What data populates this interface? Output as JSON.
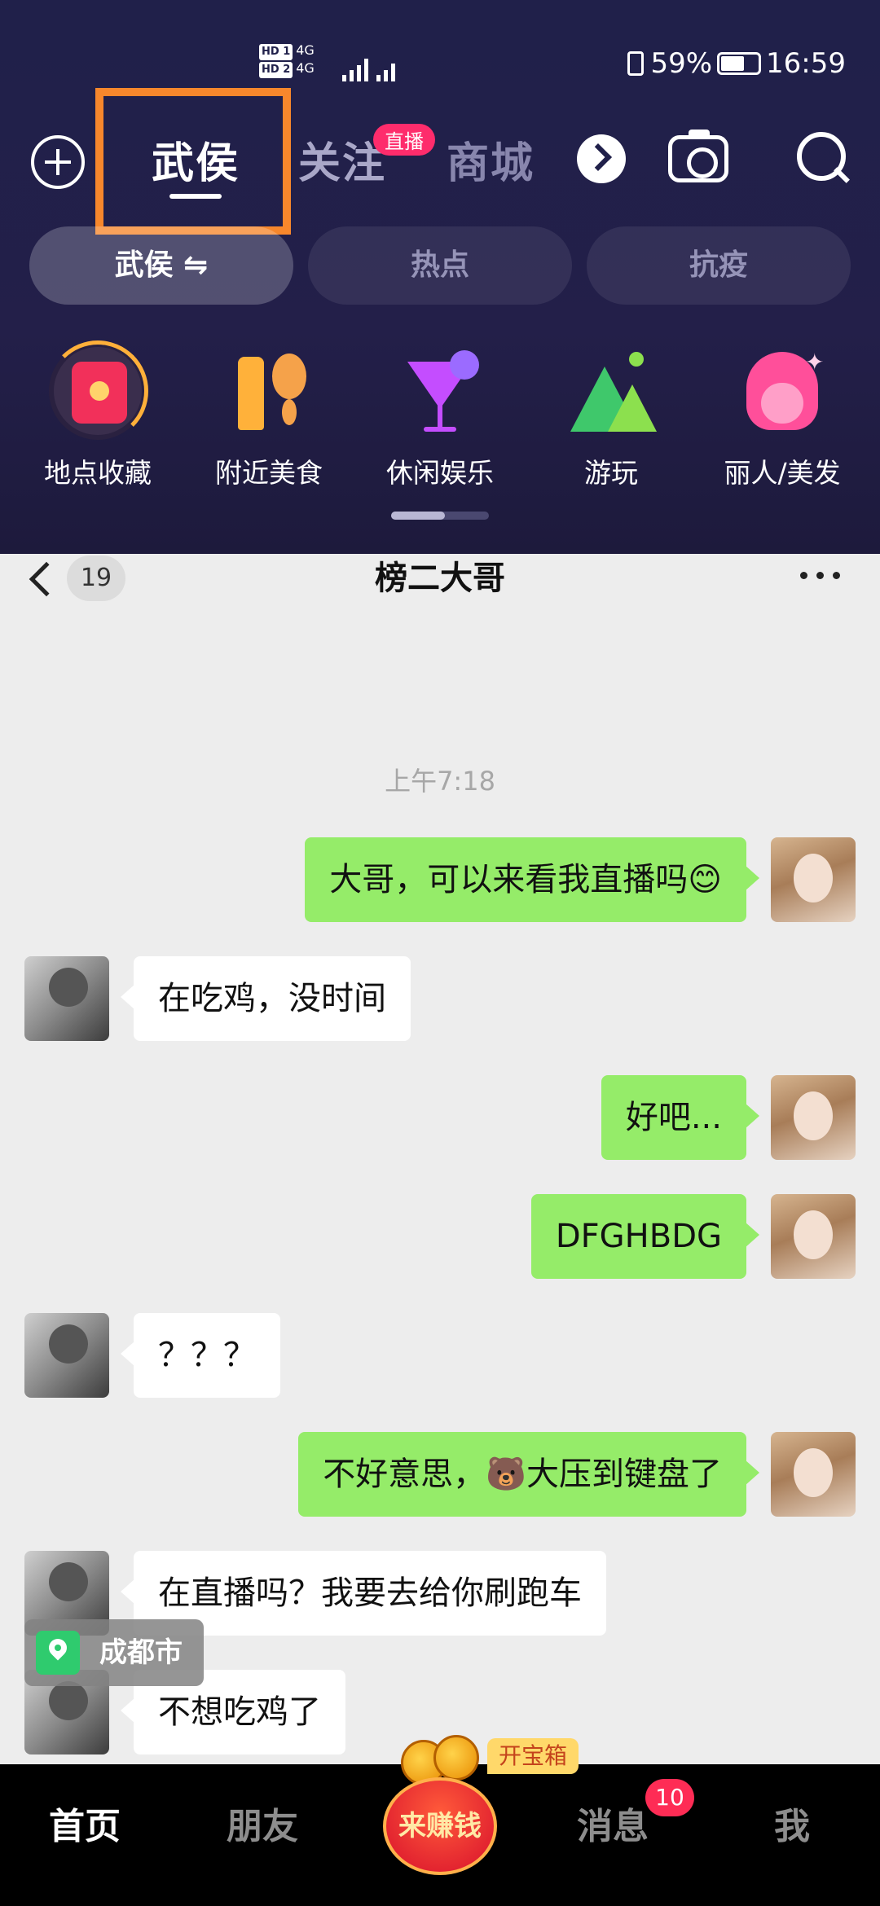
{
  "status_bar": {
    "sim_label_1": "HD 1",
    "sim_label_2": "HD 2",
    "network_1": "4G",
    "network_2": "4G",
    "battery": "59%",
    "time": "16:59"
  },
  "header": {
    "tabs": [
      {
        "label": "武侯",
        "active": true
      },
      {
        "label": "关注",
        "active": false
      },
      {
        "label": "商城",
        "active": false
      }
    ],
    "live_badge": "直播",
    "icons": [
      "plus-icon",
      "chevron-right-icon",
      "camera-icon",
      "search-icon"
    ],
    "highlight_color": "#f7872c"
  },
  "pills": [
    {
      "label": "武侯 ⇋",
      "active": true
    },
    {
      "label": "热点",
      "active": false
    },
    {
      "label": "抗疫",
      "active": false
    }
  ],
  "categories": [
    {
      "label": "地点收藏",
      "icon": "red-envelope-icon"
    },
    {
      "label": "附近美食",
      "icon": "fork-spoon-icon"
    },
    {
      "label": "休闲娱乐",
      "icon": "cocktail-icon"
    },
    {
      "label": "游玩",
      "icon": "mountain-icon"
    },
    {
      "label": "丽人/美发",
      "icon": "hair-icon"
    }
  ],
  "chat": {
    "unread_count": "19",
    "title": "榜二大哥",
    "timestamp": "上午7:18",
    "messages": [
      {
        "from": "me",
        "text": "大哥，可以来看我直播吗😊"
      },
      {
        "from": "other",
        "text": "在吃鸡，没时间"
      },
      {
        "from": "me",
        "text": "好吧..."
      },
      {
        "from": "me",
        "text": "DFGHBDG"
      },
      {
        "from": "other",
        "text": "？？？"
      },
      {
        "from": "me",
        "text": "不好意思，🐻大压到键盘了"
      },
      {
        "from": "other",
        "text": "在直播吗？我要去给你刷跑车"
      },
      {
        "from": "other",
        "text": "不想吃鸡了"
      }
    ],
    "location_chip": "成都市"
  },
  "bottom_nav": {
    "items": [
      {
        "label": "首页",
        "active": true
      },
      {
        "label": "朋友",
        "active": false
      },
      {
        "label": "来赚钱",
        "active": false
      },
      {
        "label": "消息",
        "active": false
      },
      {
        "label": "我",
        "active": false
      }
    ],
    "chest_tag": "开宝箱",
    "message_badge": "10"
  },
  "colors": {
    "header_bg": "#20204a",
    "my_bubble": "#95ec69",
    "other_bubble": "#ffffff",
    "badge_red": "#fe2c55"
  }
}
